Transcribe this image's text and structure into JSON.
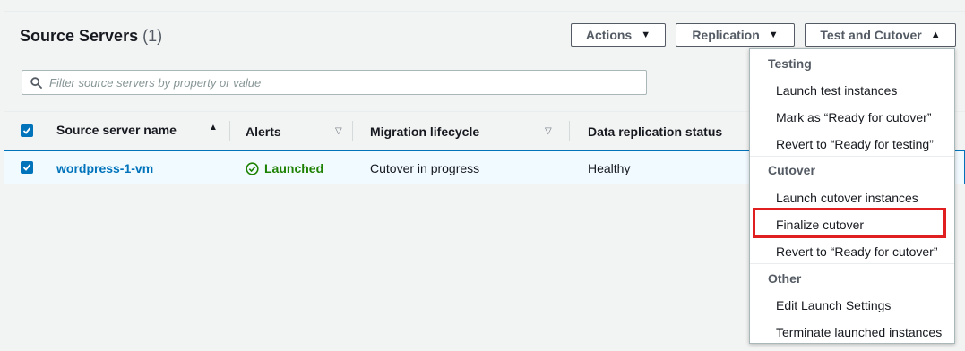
{
  "header": {
    "title": "Source Servers",
    "count": "(1)"
  },
  "buttons": {
    "actions": "Actions",
    "replication": "Replication",
    "test_cutover": "Test and Cutover"
  },
  "search": {
    "placeholder": "Filter source servers by property or value"
  },
  "table": {
    "columns": [
      "Source server name",
      "Alerts",
      "Migration lifecycle",
      "Data replication status"
    ],
    "rows": [
      {
        "name": "wordpress-1-vm",
        "alert": "Launched",
        "lifecycle": "Cutover in progress",
        "replication": "Healthy"
      }
    ]
  },
  "menu": {
    "groups": [
      {
        "label": "Testing",
        "items": [
          "Launch test instances",
          "Mark as “Ready for cutover”",
          "Revert to “Ready for testing”"
        ]
      },
      {
        "label": "Cutover",
        "items": [
          "Launch cutover instances",
          "Finalize cutover",
          "Revert to “Ready for cutover”"
        ]
      },
      {
        "label": "Other",
        "items": [
          "Edit Launch Settings",
          "Terminate launched instances"
        ]
      }
    ]
  },
  "colors": {
    "accent": "#0073bb",
    "success": "#1d8102",
    "highlight": "#e02020"
  },
  "icons": {
    "search": "search-icon",
    "check": "checkbox-checked-icon",
    "status": "status-success-icon",
    "caret_down": "caret-down-icon",
    "caret_up": "caret-up-icon",
    "sort_asc": "sort-ascending-icon",
    "sort_none": "sort-neutral-icon"
  }
}
